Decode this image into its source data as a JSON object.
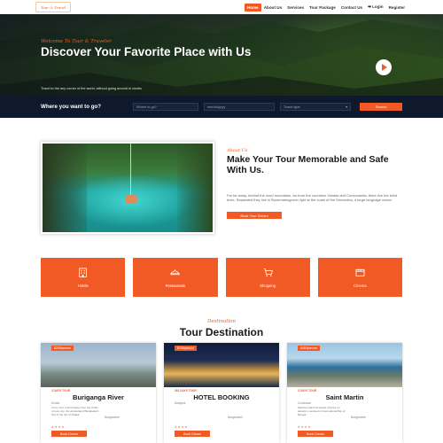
{
  "nav": {
    "logo": "Tour & Travel",
    "links": [
      "Home",
      "About Us",
      "Services",
      "Tour Package",
      "Contact Us"
    ],
    "login": "Login",
    "register": "Register"
  },
  "hero": {
    "kicker": "Welcome To Tour & Traveler",
    "title": "Discover Your Favorite Place with Us",
    "subtitle": "Travel to the any corner of the world, without going around in circles"
  },
  "search": {
    "label": "Where you want to go?",
    "where_placeholder": "Where to go?",
    "date_placeholder": "mm/dd/yyyy",
    "type_placeholder": "Travel type",
    "button": "Search"
  },
  "about": {
    "kicker": "About Us",
    "title": "Make Your Tour Memorable and Safe With Us.",
    "text": "Far far away, behind the word mountains, far from the countries Vokalia and Consonantia, there live the blind texts. Separated they live in Bookmarksgrove right at the coast of the Semantics, a large language ocean.",
    "button": "Book Your Dream"
  },
  "services": [
    {
      "label": "Hotels",
      "icon": "hotel-icon"
    },
    {
      "label": "Restaurants",
      "icon": "restaurant-icon"
    },
    {
      "label": "Shopping",
      "icon": "shopping-icon"
    },
    {
      "label": "Cinema",
      "icon": "cinema-icon"
    }
  ],
  "destination": {
    "kicker": "Destination",
    "title": "Tour Destination"
  },
  "cards": [
    {
      "price": "$200/person",
      "meta": "3 DAYS TOUR",
      "title": "Buriganga River",
      "sub": "Dhaka",
      "desc": "A tiny river a world away from the winds of pure sky, the wonderland Bangladesh Out of the city of Dhaka.",
      "loc": "Bangladesh",
      "button": "Book Dream"
    },
    {
      "price": "$199/person",
      "meta": "362 DAYS TOUR",
      "title": "HOTEL BOOKING",
      "sub": "Bangkok",
      "desc": "",
      "loc": "Bangladesh",
      "button": "Book Dream"
    },
    {
      "price": "$450/person",
      "meta": "3 DAYS TOUR",
      "title": "Saint Martin",
      "sub": "Coxsbazar",
      "desc": "Saintset island at winder physics on daniels is aerated in International Bay of Bengal.",
      "loc": "Bangladesh",
      "button": "Book Dream"
    }
  ],
  "colors": {
    "accent": "#f15a24",
    "dark": "#0e1a2c"
  }
}
